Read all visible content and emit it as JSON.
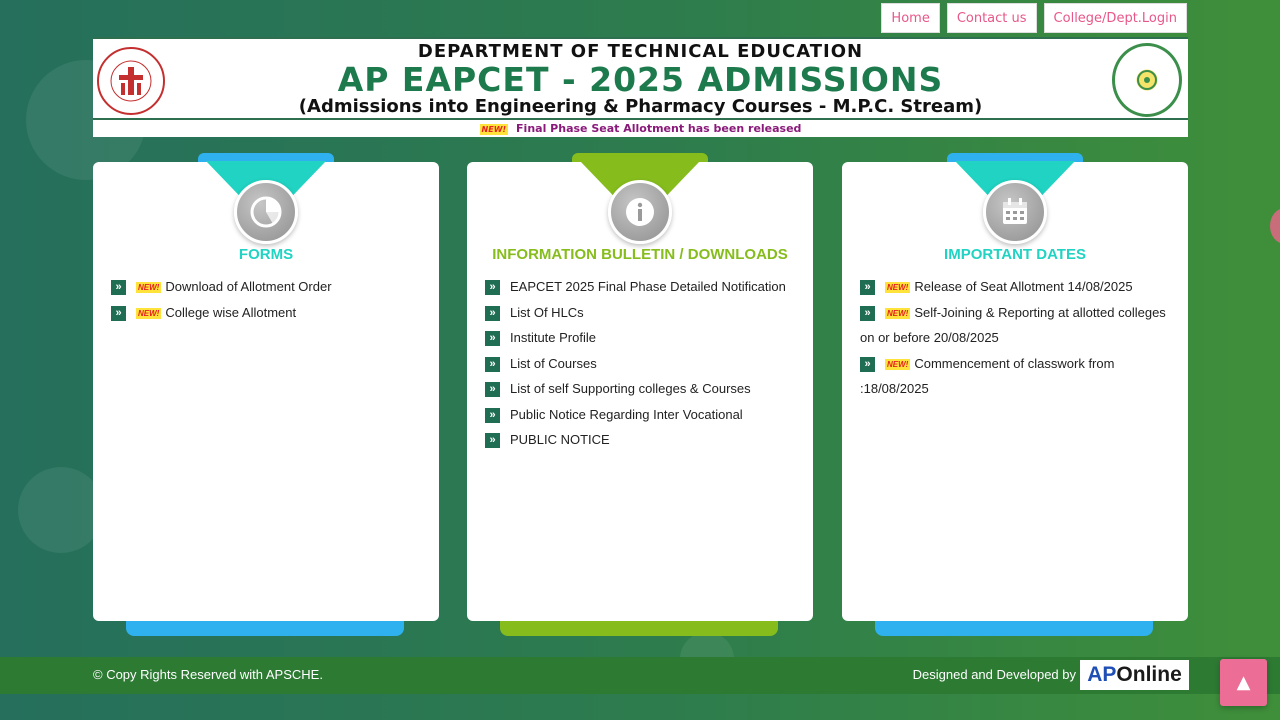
{
  "nav": {
    "home": "Home",
    "contact": "Contact us",
    "login": "College/Dept.Login"
  },
  "banner": {
    "dept": "DEPARTMENT OF TECHNICAL EDUCATION",
    "title": "AP EAPCET - 2025 ADMISSIONS",
    "subtitle": "(Admissions into Engineering & Pharmacy Courses - M.P.C. Stream)"
  },
  "ticker": {
    "badge": "NEW!",
    "text": "Final Phase Seat Allotment has been released"
  },
  "panels": [
    {
      "title": "FORMS",
      "icon": "pie-chart-icon",
      "color": "#20d3c2",
      "bar_color": "#2fb1ef",
      "items": [
        {
          "new": "NEW!",
          "text": "Download of Allotment Order"
        },
        {
          "new": "NEW!",
          "text": "College wise Allotment"
        }
      ]
    },
    {
      "title": "INFORMATION BULLETIN / DOWNLOADS",
      "icon": "info-icon",
      "color": "#86bd1d",
      "bar_color": "#86bd1d",
      "items": [
        {
          "text": "EAPCET 2025 Final Phase Detailed Notification"
        },
        {
          "text": "List Of HLCs"
        },
        {
          "text": "Institute Profile"
        },
        {
          "text": "List of Courses"
        },
        {
          "text": "List of self Supporting colleges & Courses"
        },
        {
          "text": "Public Notice Regarding Inter Vocational"
        },
        {
          "text": "PUBLIC NOTICE"
        }
      ]
    },
    {
      "title": "IMPORTANT DATES",
      "icon": "calendar-icon",
      "color": "#20d3c2",
      "bar_color": "#2fb1ef",
      "items": [
        {
          "new": "NEW!",
          "text": "Release of Seat Allotment 14/08/2025"
        },
        {
          "new": "NEW!",
          "text": "Self-Joining & Reporting at allotted colleges on or before 20/08/2025"
        },
        {
          "new": "NEW!",
          "text": "Commencement of classwork from :18/08/2025"
        }
      ]
    }
  ],
  "footer": {
    "copyright": "© Copy Rights Reserved with APSCHE.",
    "designed": "Designed and Developed by",
    "logo_ap": "AP",
    "logo_online": "Online"
  }
}
